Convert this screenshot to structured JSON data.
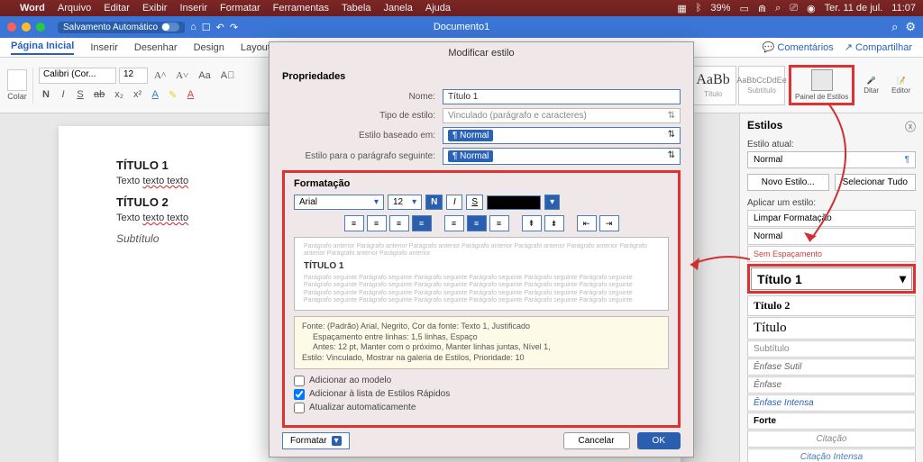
{
  "menubar": {
    "app": "Word",
    "items": [
      "Arquivo",
      "Editar",
      "Exibir",
      "Inserir",
      "Formatar",
      "Ferramentas",
      "Tabela",
      "Janela",
      "Ajuda"
    ],
    "battery": "39%",
    "date": "Ter. 11 de jul.",
    "time": "11:07"
  },
  "titlebar": {
    "autosave": "Salvamento Automático",
    "docname": "Documento1"
  },
  "tabs": {
    "items": [
      "Página Inicial",
      "Inserir",
      "Desenhar",
      "Design",
      "Layout"
    ],
    "right": [
      "Comentários",
      "Compartilhar"
    ]
  },
  "ribbon": {
    "paste": "Colar",
    "font": "Calibri (Cor...",
    "size": "12",
    "style_titulo": "Título",
    "style_pre1": "AaBb",
    "style_pre2": "AaBbCcDdEe",
    "style_sub": "Subtítulo",
    "panel": "Painel de Estilos",
    "ditar": "Ditar",
    "editor": "Editor"
  },
  "page": {
    "h1": "TÍTULO 1",
    "p1a": "Texto ",
    "p1b": "texto texto",
    "h2": "TÍTULO 2",
    "p2a": "Texto ",
    "p2b": "texto texto",
    "sub": "Subtítulo"
  },
  "stylespane": {
    "title": "Estilos",
    "cur_lbl": "Estilo atual:",
    "cur": "Normal",
    "new": "Novo Estilo...",
    "selall": "Selecionar Tudo",
    "apply_lbl": "Aplicar um estilo:",
    "items": [
      "Limpar Formatação",
      "Normal",
      "Sem Espaçamento",
      "Título 1",
      "Título 2",
      "Título",
      "Subtítulo",
      "Ênfase Sutil",
      "Ênfase",
      "Ênfase Intensa",
      "Forte",
      "Citação",
      "Citação Intensa"
    ]
  },
  "modal": {
    "title": "Modificar estilo",
    "props": "Propriedades",
    "name_lbl": "Nome:",
    "name_val": "Título 1",
    "type_lbl": "Tipo de estilo:",
    "type_val": "Vinculado (parágrafo e caracteres)",
    "based_lbl": "Estilo baseado em:",
    "based_val": "Normal",
    "next_lbl": "Estilo para o parágrafo seguinte:",
    "next_val": "Normal",
    "format": "Formatação",
    "font": "Arial",
    "size": "12",
    "preview_title": "TÍTULO 1",
    "preview_grey": "Parágrafo anterior Parágrafo anterior Parágrafo anterior Parágrafo anterior Parágrafo anterior Parágrafo anterior Parágrafo anterior Parágrafo anterior Parágrafo anterior",
    "preview_grey2": "Parágrafo seguinte Parágrafo seguinte Parágrafo seguinte Parágrafo seguinte Parágrafo seguinte Parágrafo seguinte Parágrafo seguinte Parágrafo seguinte Parágrafo seguinte Parágrafo seguinte Parágrafo seguinte Parágrafo seguinte Parágrafo seguinte Parágrafo seguinte Parágrafo seguinte Parágrafo seguinte Parágrafo seguinte Parágrafo seguinte Parágrafo seguinte Parágrafo seguinte Parágrafo seguinte Parágrafo seguinte Parágrafo seguinte Parágrafo seguinte",
    "desc1": "Fonte: (Padrão) Arial, Negrito, Cor da fonte: Texto 1, Justificado",
    "desc2": "Espaçamento entre linhas:  1,5 linhas, Espaço",
    "desc3": "Antes:  12 pt, Manter com o próximo, Manter linhas juntas, Nível 1,",
    "desc4": "Estilo: Vinculado, Mostrar na galeria de Estilos, Prioridade: 10",
    "chk1": "Adicionar ao modelo",
    "chk2": "Adicionar à lista de Estilos Rápidos",
    "chk3": "Atualizar automaticamente",
    "format_menu": "Formatar",
    "cancel": "Cancelar",
    "ok": "OK"
  }
}
